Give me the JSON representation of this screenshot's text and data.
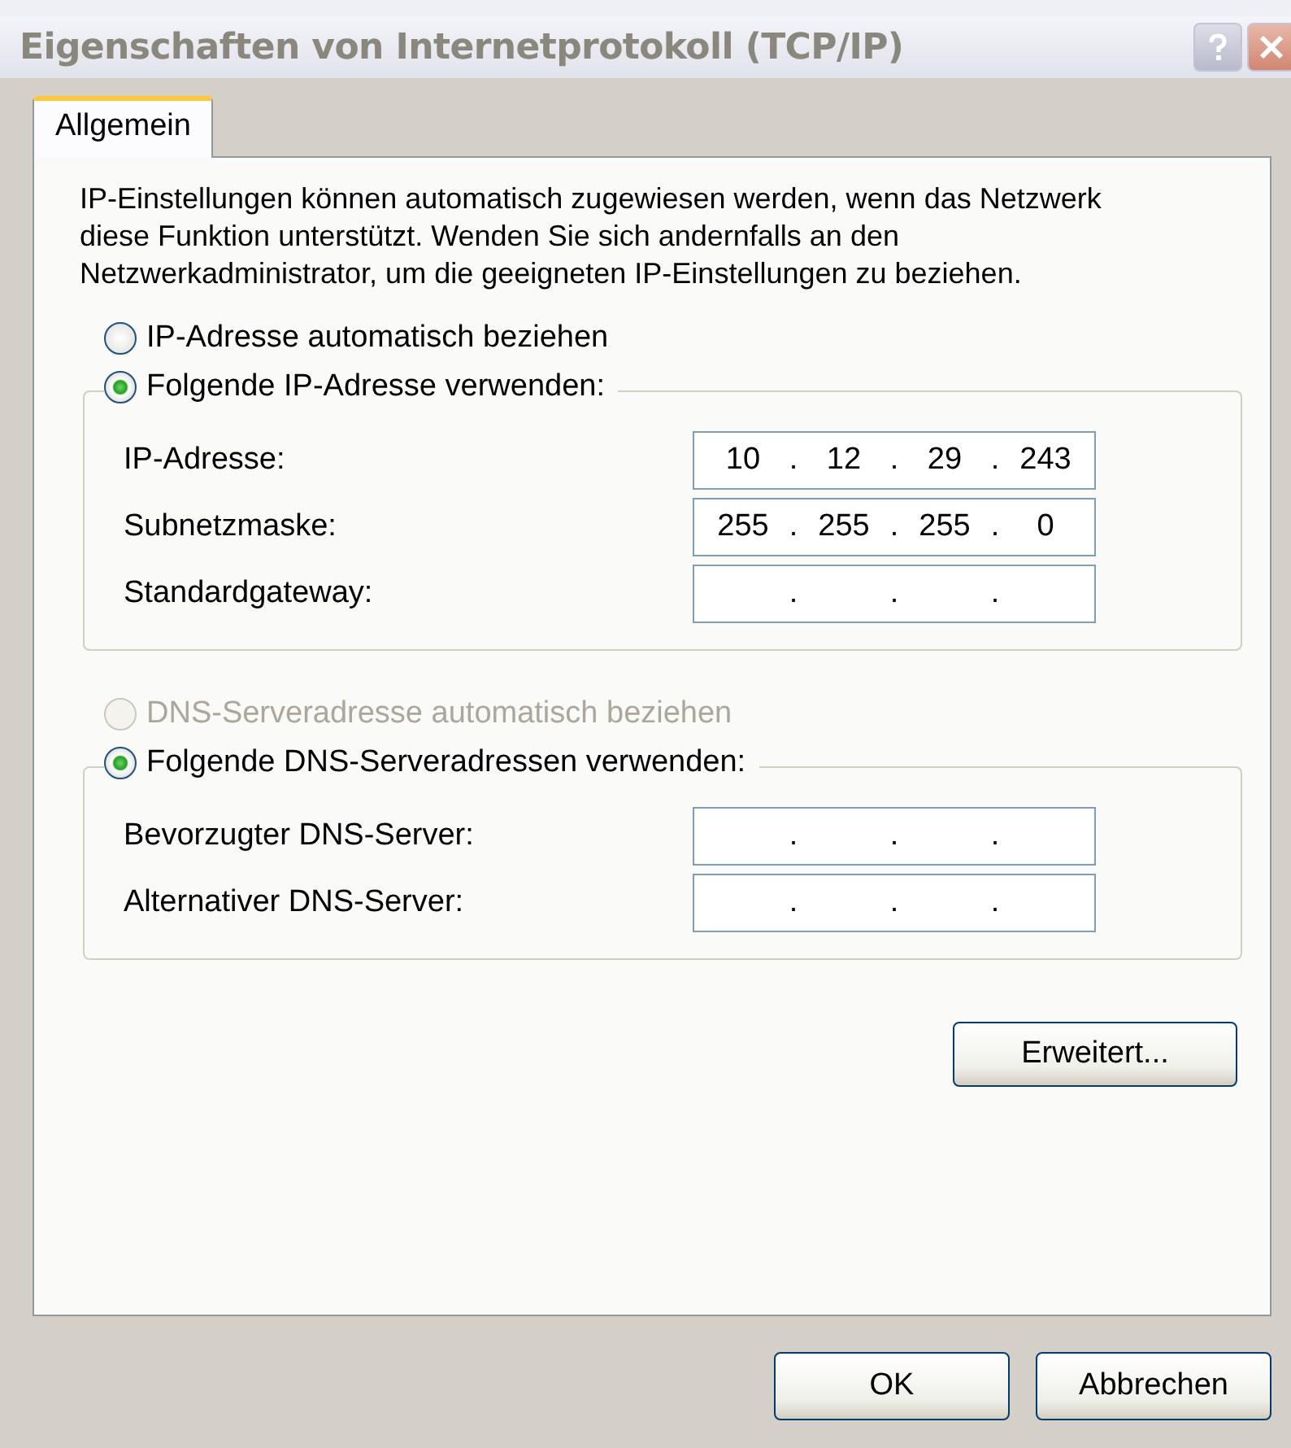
{
  "window": {
    "title": "Eigenschaften von Internetprotokoll (TCP/IP)"
  },
  "tabs": [
    {
      "label": "Allgemein",
      "selected": true
    }
  ],
  "intro": "IP-Einstellungen können automatisch zugewiesen werden, wenn das Netzwerk diese Funktion unterstützt. Wenden Sie sich andernfalls an den Netzwerkadministrator, um die geeigneten IP-Einstellungen zu beziehen.",
  "options": [
    {
      "label": "IP-Adresse automatisch beziehen",
      "selected": false,
      "disabled": false
    },
    {
      "label": "Folgende IP-Adresse verwenden:",
      "selected": true,
      "disabled": false,
      "fields": [
        {
          "label": "IP-Adresse:",
          "octets": [
            "10",
            "12",
            "29",
            "243"
          ],
          "dots": [
            ".",
            ".",
            "."
          ]
        },
        {
          "label": "Subnetzmaske:",
          "octets": [
            "255",
            "255",
            "255",
            "0"
          ],
          "dots": [
            ".",
            ".",
            "."
          ]
        },
        {
          "label": "Standardgateway:",
          "dots": [
            ".",
            ".",
            "."
          ]
        }
      ]
    },
    {
      "label": "DNS-Serveradresse automatisch beziehen",
      "selected": false,
      "disabled": true
    },
    {
      "label": "Folgende DNS-Serveradressen verwenden:",
      "selected": true,
      "disabled": false,
      "fields": [
        {
          "label": "Bevorzugter DNS-Server:",
          "dots": [
            ".",
            ".",
            "."
          ]
        },
        {
          "label": "Alternativer DNS-Server:",
          "dots": [
            ".",
            ".",
            "."
          ]
        }
      ]
    }
  ],
  "advanced_button": "Erweitert...",
  "buttons": [
    "OK",
    "Abbrechen"
  ]
}
